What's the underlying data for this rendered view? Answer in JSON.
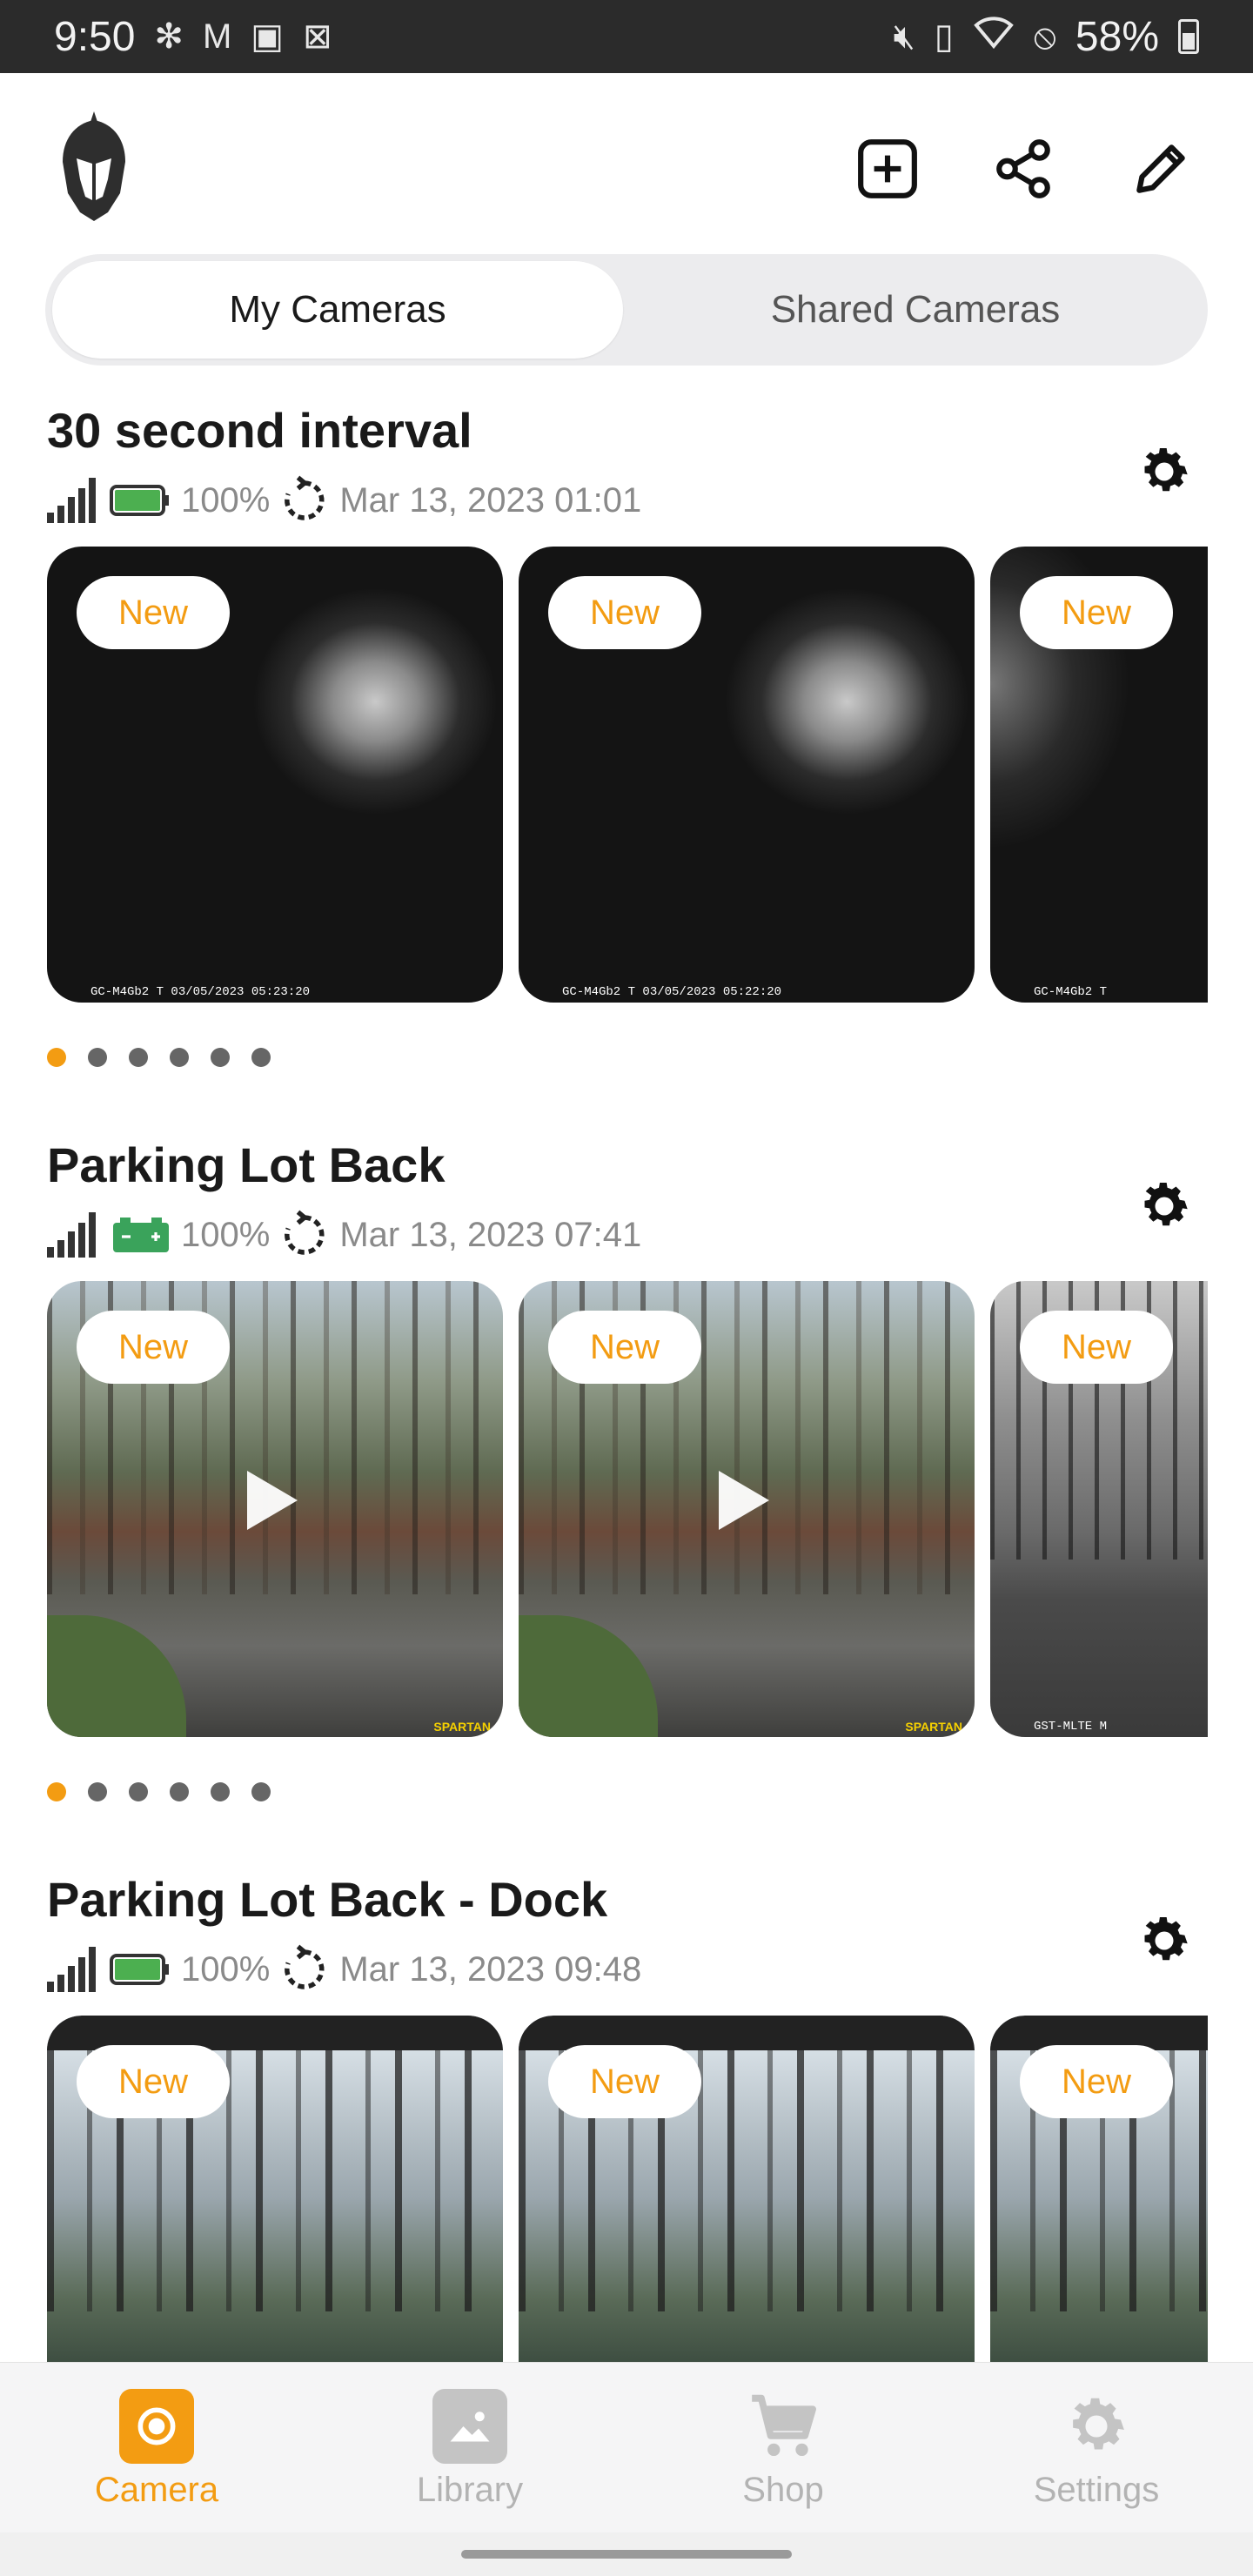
{
  "status_bar": {
    "time": "9:50",
    "battery_percent": "58%",
    "left_icons": [
      "pinwheel-icon",
      "gmail-icon",
      "gallery-icon",
      "sim-icon"
    ],
    "right_icons": [
      "mute-icon",
      "nfc-icon",
      "wifi-icon",
      "dnd-icon",
      "battery-icon"
    ]
  },
  "header": {
    "logo": "spartan-helmet-logo",
    "actions": [
      "add-camera-icon",
      "share-icon",
      "edit-icon"
    ]
  },
  "segments": {
    "active": "My Cameras",
    "inactive": "Shared Cameras"
  },
  "cameras": [
    {
      "name": "30 second interval",
      "battery_percent": "100%",
      "last_update": "Mar 13, 2023 01:01",
      "battery_type": "green-battery",
      "thumbnails": [
        {
          "badge": "New",
          "stamp": "GC-M4Gb2        T        03/05/2023 05:23:20",
          "kind": "ir"
        },
        {
          "badge": "New",
          "stamp": "GC-M4Gb2        T        03/05/2023 05:22:20",
          "kind": "ir"
        },
        {
          "badge": "New",
          "stamp": "GC-M4Gb2        T",
          "kind": "ir-dark"
        }
      ],
      "dot_count": 6,
      "active_dot": 0
    },
    {
      "name": "Parking Lot Back",
      "battery_percent": "100%",
      "last_update": "Mar 13, 2023 07:41",
      "battery_type": "car-battery",
      "thumbnails": [
        {
          "badge": "New",
          "stamp_right": "SPARTAN",
          "kind": "video-day"
        },
        {
          "badge": "New",
          "stamp_right": "SPARTAN",
          "kind": "video-day"
        },
        {
          "badge": "New",
          "stamp": "GST-MLTE        M",
          "kind": "gray"
        }
      ],
      "dot_count": 6,
      "active_dot": 0
    },
    {
      "name": "Parking Lot Back - Dock",
      "battery_percent": "100%",
      "last_update": "Mar 13, 2023 09:48",
      "battery_type": "green-battery",
      "thumbnails": [
        {
          "badge": "New",
          "kind": "forest"
        },
        {
          "badge": "New",
          "kind": "forest"
        },
        {
          "badge": "New",
          "kind": "forest"
        }
      ]
    }
  ],
  "tabs": [
    {
      "label": "Camera",
      "icon": "camera-tab-icon",
      "active": true
    },
    {
      "label": "Library",
      "icon": "library-tab-icon",
      "active": false
    },
    {
      "label": "Shop",
      "icon": "cart-tab-icon",
      "active": false
    },
    {
      "label": "Settings",
      "icon": "gear-tab-icon",
      "active": false
    }
  ],
  "colors": {
    "accent": "#f39c12",
    "battery_green": "#4caf50"
  }
}
